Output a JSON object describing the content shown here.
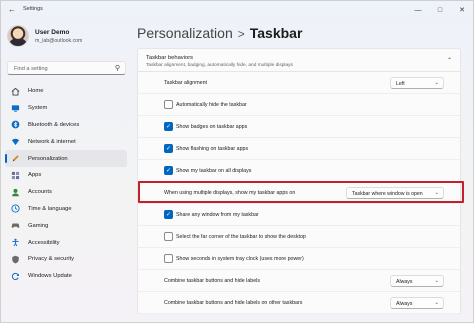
{
  "window": {
    "title": "Settings"
  },
  "user": {
    "name": "User Demo",
    "email": "m_lab@outlook.com"
  },
  "search": {
    "placeholder": "Find a setting"
  },
  "nav": [
    {
      "label": "Home",
      "icon": "home-icon",
      "color": "#444444"
    },
    {
      "label": "System",
      "icon": "monitor-icon",
      "color": "#0a6cc4"
    },
    {
      "label": "Bluetooth & devices",
      "icon": "bluetooth-icon",
      "color": "#0a6cc4"
    },
    {
      "label": "Network & internet",
      "icon": "wifi-icon",
      "color": "#0a6cc4"
    },
    {
      "label": "Personalization",
      "icon": "pencil-icon",
      "color": "#d08a2c",
      "active": true
    },
    {
      "label": "Apps",
      "icon": "apps-icon",
      "color": "#6a6a9a"
    },
    {
      "label": "Accounts",
      "icon": "person-icon",
      "color": "#2b8a3e"
    },
    {
      "label": "Time & language",
      "icon": "globe-clock-icon",
      "color": "#0a6cc4"
    },
    {
      "label": "Gaming",
      "icon": "gamepad-icon",
      "color": "#6a6a6a"
    },
    {
      "label": "Accessibility",
      "icon": "accessibility-icon",
      "color": "#0a6cc4"
    },
    {
      "label": "Privacy & security",
      "icon": "shield-icon",
      "color": "#6a6a6a"
    },
    {
      "label": "Windows Update",
      "icon": "update-icon",
      "color": "#0a6cc4"
    }
  ],
  "breadcrumb": {
    "parent": "Personalization",
    "separator": ">",
    "current": "Taskbar"
  },
  "section": {
    "title": "Taskbar behaviors",
    "subtitle": "Taskbar alignment, badging, automatically hide, and multiple displays"
  },
  "rows": {
    "alignment": {
      "label": "Taskbar alignment",
      "value": "Left"
    },
    "auto_hide": {
      "label": "Automatically hide the taskbar",
      "checked": false
    },
    "badges": {
      "label": "Show badges on taskbar apps",
      "checked": true
    },
    "flashing": {
      "label": "Show flashing on taskbar apps",
      "checked": true
    },
    "all_displays": {
      "label": "Show my taskbar on all displays",
      "checked": true
    },
    "multi_display": {
      "label": "When using multiple displays, show my taskbar apps on",
      "value": "Taskbar where window is open"
    },
    "share_window": {
      "label": "Share any window from my taskbar",
      "checked": true
    },
    "far_corner": {
      "label": "Select the far corner of the taskbar to show the desktop",
      "checked": false
    },
    "seconds": {
      "label": "Show seconds in system tray clock (uses more power)",
      "checked": false
    },
    "combine": {
      "label": "Combine taskbar buttons and hide labels",
      "value": "Always"
    },
    "combine_other": {
      "label": "Combine taskbar buttons and hide labels on other taskbars",
      "value": "Always"
    }
  },
  "colors": {
    "accent": "#0067c0",
    "highlight": "#c41f2a"
  }
}
